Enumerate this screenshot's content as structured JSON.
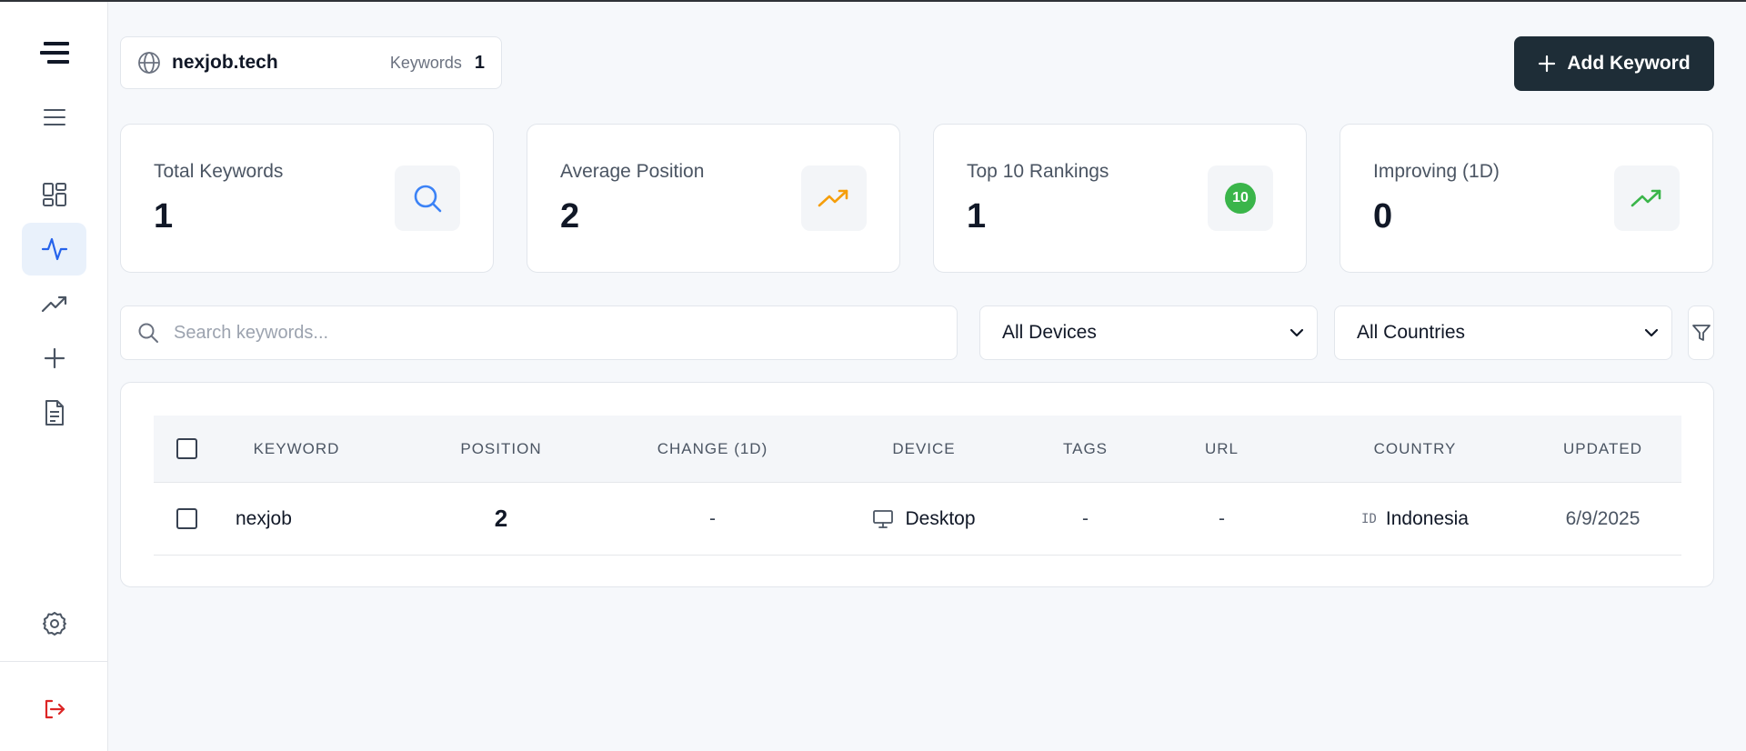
{
  "header": {
    "domain": "nexjob.tech",
    "keywords_label": "Keywords",
    "keywords_count": "1",
    "add_button_label": "Add Keyword"
  },
  "sidebar": {
    "items": [
      {
        "name": "logo",
        "icon": "brand-logo-icon"
      },
      {
        "name": "menu",
        "icon": "menu-icon"
      },
      {
        "name": "dashboard",
        "icon": "dashboard-grid-icon"
      },
      {
        "name": "activity",
        "icon": "activity-pulse-icon",
        "active": true
      },
      {
        "name": "trends",
        "icon": "trending-up-icon"
      },
      {
        "name": "add",
        "icon": "plus-icon"
      },
      {
        "name": "reports",
        "icon": "document-icon"
      },
      {
        "name": "settings",
        "icon": "gear-icon"
      },
      {
        "name": "logout",
        "icon": "logout-icon"
      }
    ]
  },
  "stats": [
    {
      "title": "Total Keywords",
      "value": "1",
      "icon": "search-icon",
      "color": "#3b82f6"
    },
    {
      "title": "Average Position",
      "value": "2",
      "icon": "trending-up-icon",
      "color": "#f59e0b"
    },
    {
      "title": "Top 10 Rankings",
      "value": "1",
      "icon": "top10-badge-icon",
      "badge": "10",
      "color": "#3ab54a"
    },
    {
      "title": "Improving (1D)",
      "value": "0",
      "icon": "trending-up-icon",
      "color": "#3ab54a"
    }
  ],
  "filters": {
    "search_placeholder": "Search keywords...",
    "device_selected": "All Devices",
    "country_selected": "All Countries"
  },
  "table": {
    "columns": [
      "KEYWORD",
      "POSITION",
      "CHANGE (1D)",
      "DEVICE",
      "TAGS",
      "URL",
      "COUNTRY",
      "UPDATED"
    ],
    "rows": [
      {
        "keyword": "nexjob",
        "position": "2",
        "change": "-",
        "device": "Desktop",
        "tags": "-",
        "url": "-",
        "country_code": "ID",
        "country": "Indonesia",
        "updated": "6/9/2025"
      }
    ]
  },
  "colors": {
    "accent_dark": "#1e2d37",
    "active_blue": "#2563eb",
    "logout_red": "#dc2626"
  }
}
